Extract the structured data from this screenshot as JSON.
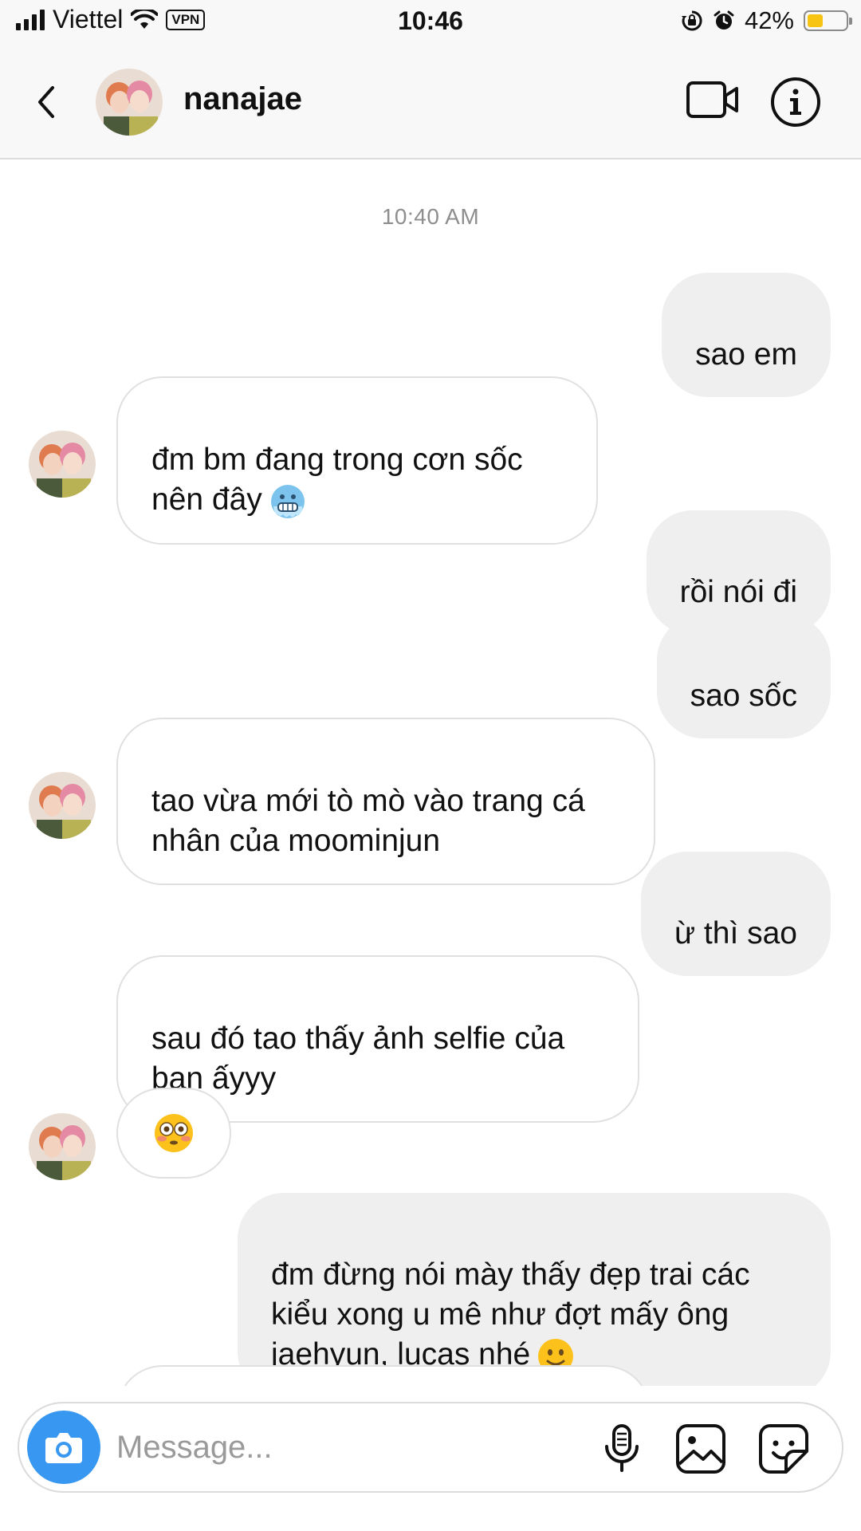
{
  "status_bar": {
    "carrier": "Viettel",
    "vpn_label": "VPN",
    "time": "10:46",
    "battery_text": "42%",
    "battery_level": 0.42,
    "battery_color": "#f7c414"
  },
  "header": {
    "username": "nanajae",
    "back_icon": "chevron-left-icon",
    "video_icon": "video-camera-icon",
    "info_icon": "info-icon"
  },
  "chat": {
    "timestamp": "10:40 AM",
    "messages": [
      {
        "direction": "outgoing",
        "text": "sao em"
      },
      {
        "direction": "incoming",
        "text": "đm bm đang trong cơn sốc\nnên đây",
        "emoji": "cold-face-emoji"
      },
      {
        "direction": "outgoing",
        "text": "rồi nói đi"
      },
      {
        "direction": "outgoing",
        "text": "sao sốc"
      },
      {
        "direction": "incoming",
        "text": "tao vừa mới tò mò vào trang cá\nnhân của moominjun"
      },
      {
        "direction": "outgoing",
        "text": "ừ thì sao"
      },
      {
        "direction": "incoming",
        "text": "sau đó tao thấy ảnh selfie của\nbạn ấyyy"
      },
      {
        "direction": "incoming",
        "text": "",
        "emoji": "flushed-face-emoji"
      },
      {
        "direction": "outgoing",
        "text": "đm đừng nói mày thấy đẹp trai các\nkiểu xong u mê như đợt mấy ông\njaehyun, lucas nhé",
        "emoji": "slightly-smiling-face-emoji"
      }
    ]
  },
  "composer": {
    "placeholder": "Message...",
    "camera_icon": "camera-icon",
    "mic_icon": "microphone-icon",
    "gallery_icon": "gallery-icon",
    "sticker_icon": "sticker-icon",
    "accent_color": "#3897f0"
  },
  "colors": {
    "outgoing_bubble": "#efefef",
    "incoming_border": "#e0e0e0",
    "timestamp": "#8e8e8e"
  }
}
